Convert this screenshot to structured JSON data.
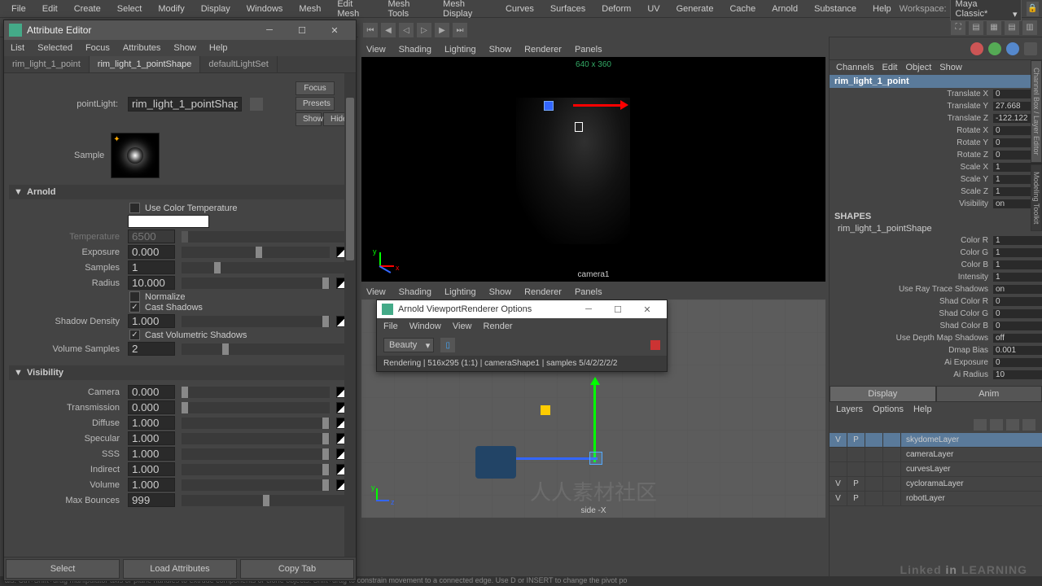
{
  "menubar": {
    "items": [
      "File",
      "Edit",
      "Create",
      "Select",
      "Modify",
      "Display",
      "Windows",
      "Mesh",
      "Edit Mesh",
      "Mesh Tools",
      "Mesh Display",
      "Curves",
      "Surfaces",
      "Deform",
      "UV",
      "Generate",
      "Cache",
      "Arnold",
      "Substance",
      "Help"
    ],
    "workspace_label": "Workspace:",
    "workspace_value": "Maya Classic*"
  },
  "attr_editor": {
    "title": "Attribute Editor",
    "menu": [
      "List",
      "Selected",
      "Focus",
      "Attributes",
      "Show",
      "Help"
    ],
    "tabs": [
      "rim_light_1_point",
      "rim_light_1_pointShape",
      "defaultLightSet"
    ],
    "active_tab": 1,
    "pointlight_label": "pointLight:",
    "pointlight_value": "rim_light_1_pointShape",
    "side_btns": {
      "focus": "Focus",
      "presets": "Presets",
      "show": "Show",
      "hide": "Hide"
    },
    "sample_label": "Sample",
    "sections": {
      "arnold": {
        "name": "Arnold",
        "use_color_temp": "Use Color Temperature",
        "temperature_label": "Temperature",
        "temperature_value": "6500",
        "exposure_label": "Exposure",
        "exposure_value": "0.000",
        "samples_label": "Samples",
        "samples_value": "1",
        "radius_label": "Radius",
        "radius_value": "10.000",
        "normalize": "Normalize",
        "cast_shadows": "Cast Shadows",
        "shadow_density_label": "Shadow Density",
        "shadow_density_value": "1.000",
        "cast_vol_shadows": "Cast Volumetric Shadows",
        "vol_samples_label": "Volume Samples",
        "vol_samples_value": "2"
      },
      "visibility": {
        "name": "Visibility",
        "camera_label": "Camera",
        "camera_value": "0.000",
        "transmission_label": "Transmission",
        "transmission_value": "0.000",
        "diffuse_label": "Diffuse",
        "diffuse_value": "1.000",
        "specular_label": "Specular",
        "specular_value": "1.000",
        "sss_label": "SSS",
        "sss_value": "1.000",
        "indirect_label": "Indirect",
        "indirect_value": "1.000",
        "volume_label": "Volume",
        "volume_value": "1.000",
        "max_bounces_label": "Max Bounces",
        "max_bounces_value": "999"
      }
    },
    "footer": {
      "select": "Select",
      "load": "Load Attributes",
      "copy": "Copy Tab"
    }
  },
  "viewport": {
    "menu": [
      "View",
      "Shading",
      "Lighting",
      "Show",
      "Renderer",
      "Panels"
    ],
    "top_label": "640 x 360",
    "camera_label": "camera1",
    "menu2": [
      "View",
      "Shading",
      "Lighting",
      "Show",
      "Renderer",
      "Panels"
    ],
    "side_label": "side -X"
  },
  "arnold": {
    "title": "Arnold ViewportRenderer Options",
    "menu": [
      "File",
      "Window",
      "View",
      "Render"
    ],
    "aov": "Beauty",
    "status": "Rendering | 516x295 (1:1) | cameraShape1 | samples 5/4/2/2/2/2"
  },
  "channel_box": {
    "menu": [
      "Channels",
      "Edit",
      "Object",
      "Show"
    ],
    "node": "rim_light_1_point",
    "xform": [
      {
        "label": "Translate X",
        "value": "0"
      },
      {
        "label": "Translate Y",
        "value": "27.668"
      },
      {
        "label": "Translate Z",
        "value": "-122.122"
      },
      {
        "label": "Rotate X",
        "value": "0"
      },
      {
        "label": "Rotate Y",
        "value": "0"
      },
      {
        "label": "Rotate Z",
        "value": "0"
      },
      {
        "label": "Scale X",
        "value": "1"
      },
      {
        "label": "Scale Y",
        "value": "1"
      },
      {
        "label": "Scale Z",
        "value": "1"
      },
      {
        "label": "Visibility",
        "value": "on"
      }
    ],
    "shapes_label": "SHAPES",
    "shape_name": "rim_light_1_pointShape",
    "shape_attrs": [
      {
        "label": "Color R",
        "value": "1"
      },
      {
        "label": "Color G",
        "value": "1"
      },
      {
        "label": "Color B",
        "value": "1"
      },
      {
        "label": "Intensity",
        "value": "1"
      },
      {
        "label": "Use Ray Trace Shadows",
        "value": "on"
      },
      {
        "label": "Shad Color R",
        "value": "0"
      },
      {
        "label": "Shad Color G",
        "value": "0"
      },
      {
        "label": "Shad Color B",
        "value": "0"
      },
      {
        "label": "Use Depth Map Shadows",
        "value": "off"
      },
      {
        "label": "Dmap Bias",
        "value": "0.001"
      },
      {
        "label": "Ai Exposure",
        "value": "0"
      },
      {
        "label": "Ai Radius",
        "value": "10"
      }
    ],
    "display_tab": "Display",
    "anim_tab": "Anim",
    "layers_menu": [
      "Layers",
      "Options",
      "Help"
    ],
    "layers": [
      {
        "v": "V",
        "p": "P",
        "name": "skydomeLayer",
        "active": true
      },
      {
        "v": "",
        "p": "",
        "name": "cameraLayer",
        "active": false
      },
      {
        "v": "",
        "p": "",
        "name": "curvesLayer",
        "active": false
      },
      {
        "v": "V",
        "p": "P",
        "name": "cycloramaLayer",
        "active": false
      },
      {
        "v": "V",
        "p": "P",
        "name": "robotLayer",
        "active": false
      }
    ]
  },
  "side_tabs": [
    "Channel Box / Layer Editor",
    "Modeling Toolkit"
  ],
  "statusbar": "als. Ctrl+Shift+drag manipulator axis or plane handles to extrude components or clone objects. Shift+drag to constrain movement to a connected edge. Use D or INSERT to change the pivot po",
  "watermark_linkedin": "Linked in LEARNING"
}
